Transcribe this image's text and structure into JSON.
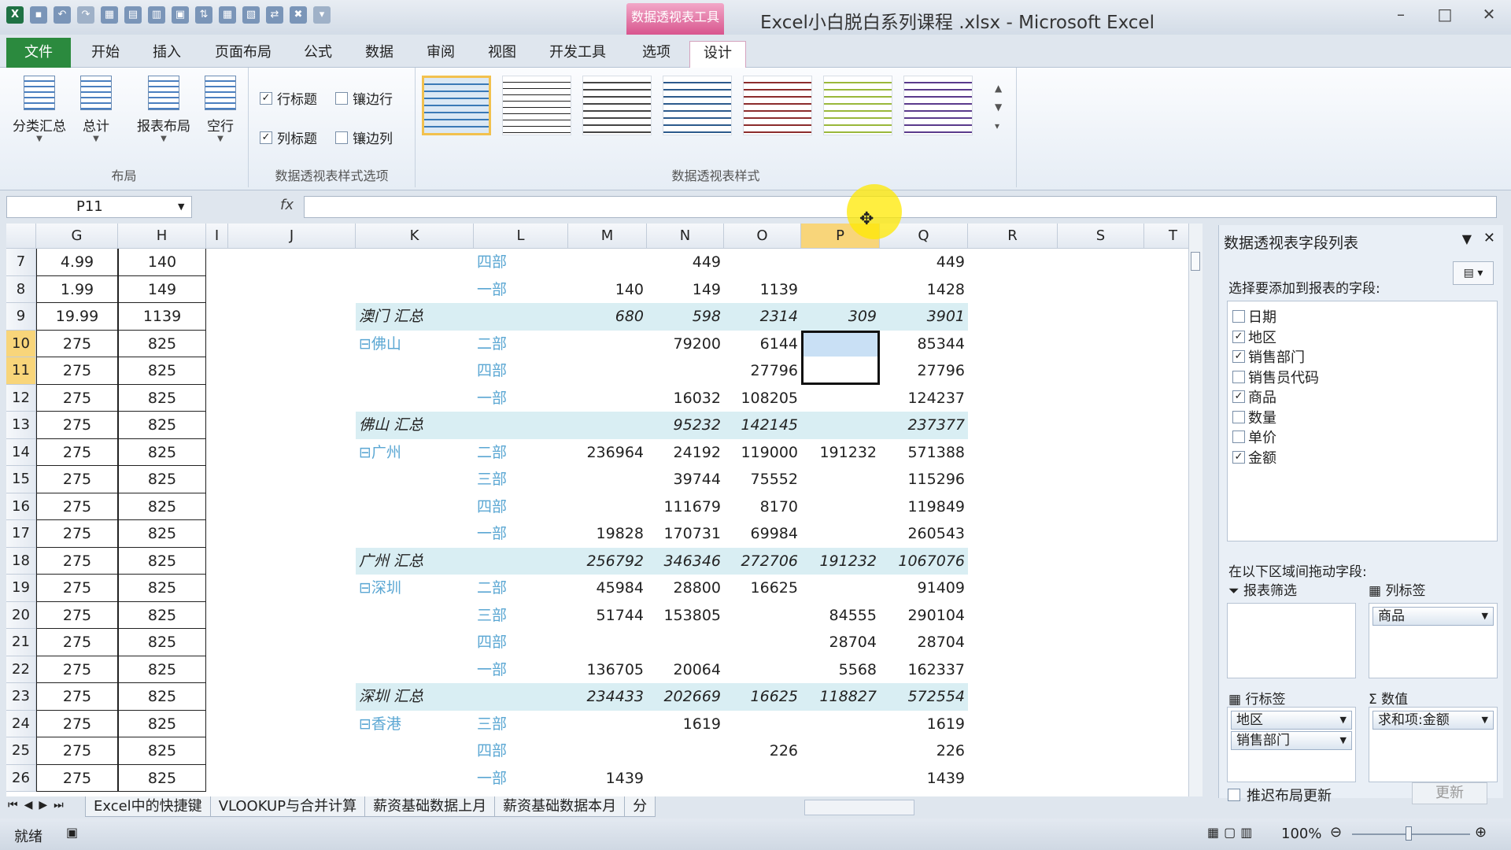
{
  "window": {
    "title": "Excel小白脱白系列课程 .xlsx - Microsoft Excel",
    "tool_tab": "数据透视表工具"
  },
  "tabs": [
    "文件",
    "开始",
    "插入",
    "页面布局",
    "公式",
    "数据",
    "审阅",
    "视图",
    "开发工具",
    "选项",
    "设计"
  ],
  "ribbon": {
    "layout_buttons": [
      "分类汇总",
      "总计",
      "报表布局",
      "空行"
    ],
    "layout_label": "布局",
    "options": [
      {
        "label": "行标题",
        "checked": true
      },
      {
        "label": "镶边行",
        "checked": false
      },
      {
        "label": "列标题",
        "checked": true
      },
      {
        "label": "镶边列",
        "checked": false
      }
    ],
    "options_label": "数据透视表样式选项",
    "styles_label": "数据透视表样式"
  },
  "formula": {
    "namebox": "P11",
    "fx": "fx"
  },
  "columns": [
    "G",
    "H",
    "I",
    "J",
    "K",
    "L",
    "M",
    "N",
    "O",
    "P",
    "Q",
    "R",
    "S",
    "T"
  ],
  "rows": [
    {
      "n": "7",
      "g": "4.99",
      "h": "140",
      "k": "",
      "l": "四部",
      "m": "",
      "nn": "449",
      "o": "",
      "p": "",
      "q": "449",
      "type": "d"
    },
    {
      "n": "8",
      "g": "1.99",
      "h": "149",
      "k": "",
      "l": "一部",
      "m": "140",
      "nn": "149",
      "o": "1139",
      "p": "",
      "q": "1428",
      "type": "d"
    },
    {
      "n": "9",
      "g": "19.99",
      "h": "1139",
      "k": "澳门 汇总",
      "l": "",
      "m": "680",
      "nn": "598",
      "o": "2314",
      "p": "309",
      "q": "3901",
      "type": "s"
    },
    {
      "n": "10",
      "g": "275",
      "h": "825",
      "k": "⊟佛山",
      "l": "二部",
      "m": "",
      "nn": "79200",
      "o": "6144",
      "p": "",
      "q": "85344",
      "type": "d"
    },
    {
      "n": "11",
      "g": "275",
      "h": "825",
      "k": "",
      "l": "四部",
      "m": "",
      "nn": "",
      "o": "27796",
      "p": "",
      "q": "27796",
      "type": "d"
    },
    {
      "n": "12",
      "g": "275",
      "h": "825",
      "k": "",
      "l": "一部",
      "m": "",
      "nn": "16032",
      "o": "108205",
      "p": "",
      "q": "124237",
      "type": "d"
    },
    {
      "n": "13",
      "g": "275",
      "h": "825",
      "k": "佛山 汇总",
      "l": "",
      "m": "",
      "nn": "95232",
      "o": "142145",
      "p": "",
      "q": "237377",
      "type": "s"
    },
    {
      "n": "14",
      "g": "275",
      "h": "825",
      "k": "⊟广州",
      "l": "二部",
      "m": "236964",
      "nn": "24192",
      "o": "119000",
      "p": "191232",
      "q": "571388",
      "type": "d"
    },
    {
      "n": "15",
      "g": "275",
      "h": "825",
      "k": "",
      "l": "三部",
      "m": "",
      "nn": "39744",
      "o": "75552",
      "p": "",
      "q": "115296",
      "type": "d"
    },
    {
      "n": "16",
      "g": "275",
      "h": "825",
      "k": "",
      "l": "四部",
      "m": "",
      "nn": "111679",
      "o": "8170",
      "p": "",
      "q": "119849",
      "type": "d"
    },
    {
      "n": "17",
      "g": "275",
      "h": "825",
      "k": "",
      "l": "一部",
      "m": "19828",
      "nn": "170731",
      "o": "69984",
      "p": "",
      "q": "260543",
      "type": "d"
    },
    {
      "n": "18",
      "g": "275",
      "h": "825",
      "k": "广州 汇总",
      "l": "",
      "m": "256792",
      "nn": "346346",
      "o": "272706",
      "p": "191232",
      "q": "1067076",
      "type": "s"
    },
    {
      "n": "19",
      "g": "275",
      "h": "825",
      "k": "⊟深圳",
      "l": "二部",
      "m": "45984",
      "nn": "28800",
      "o": "16625",
      "p": "",
      "q": "91409",
      "type": "d"
    },
    {
      "n": "20",
      "g": "275",
      "h": "825",
      "k": "",
      "l": "三部",
      "m": "51744",
      "nn": "153805",
      "o": "",
      "p": "84555",
      "q": "290104",
      "type": "d"
    },
    {
      "n": "21",
      "g": "275",
      "h": "825",
      "k": "",
      "l": "四部",
      "m": "",
      "nn": "",
      "o": "",
      "p": "28704",
      "q": "28704",
      "type": "d"
    },
    {
      "n": "22",
      "g": "275",
      "h": "825",
      "k": "",
      "l": "一部",
      "m": "136705",
      "nn": "20064",
      "o": "",
      "p": "5568",
      "q": "162337",
      "type": "d"
    },
    {
      "n": "23",
      "g": "275",
      "h": "825",
      "k": "深圳 汇总",
      "l": "",
      "m": "234433",
      "nn": "202669",
      "o": "16625",
      "p": "118827",
      "q": "572554",
      "type": "s"
    },
    {
      "n": "24",
      "g": "275",
      "h": "825",
      "k": "⊟香港",
      "l": "三部",
      "m": "",
      "nn": "1619",
      "o": "",
      "p": "",
      "q": "1619",
      "type": "d"
    },
    {
      "n": "25",
      "g": "275",
      "h": "825",
      "k": "",
      "l": "四部",
      "m": "",
      "nn": "",
      "o": "226",
      "p": "",
      "q": "226",
      "type": "d"
    },
    {
      "n": "26",
      "g": "275",
      "h": "825",
      "k": "",
      "l": "一部",
      "m": "1439",
      "nn": "",
      "o": "",
      "p": "",
      "q": "1439",
      "type": "d"
    }
  ],
  "pane": {
    "title": "数据透视表字段列表",
    "choose_label": "选择要添加到报表的字段:",
    "fields": [
      {
        "label": "日期",
        "checked": false
      },
      {
        "label": "地区",
        "checked": true
      },
      {
        "label": "销售部门",
        "checked": true
      },
      {
        "label": "销售员代码",
        "checked": false
      },
      {
        "label": "商品",
        "checked": true
      },
      {
        "label": "数量",
        "checked": false
      },
      {
        "label": "单价",
        "checked": false
      },
      {
        "label": "金额",
        "checked": true
      }
    ],
    "drag_label": "在以下区域间拖动字段:",
    "filter_label": "报表筛选",
    "col_label": "列标签",
    "row_label": "行标签",
    "values_label": "数值",
    "col_items": [
      "商品"
    ],
    "row_items": [
      "地区",
      "销售部门"
    ],
    "value_items": [
      "求和项:金额"
    ],
    "defer_label": "推迟布局更新",
    "update_label": "更新"
  },
  "sheets": [
    "Excel中的快捷键",
    "VLOOKUP与合并计算",
    "薪资基础数据上月",
    "薪资基础数据本月",
    "分"
  ],
  "status": {
    "ready": "就绪",
    "zoom": "100%"
  }
}
